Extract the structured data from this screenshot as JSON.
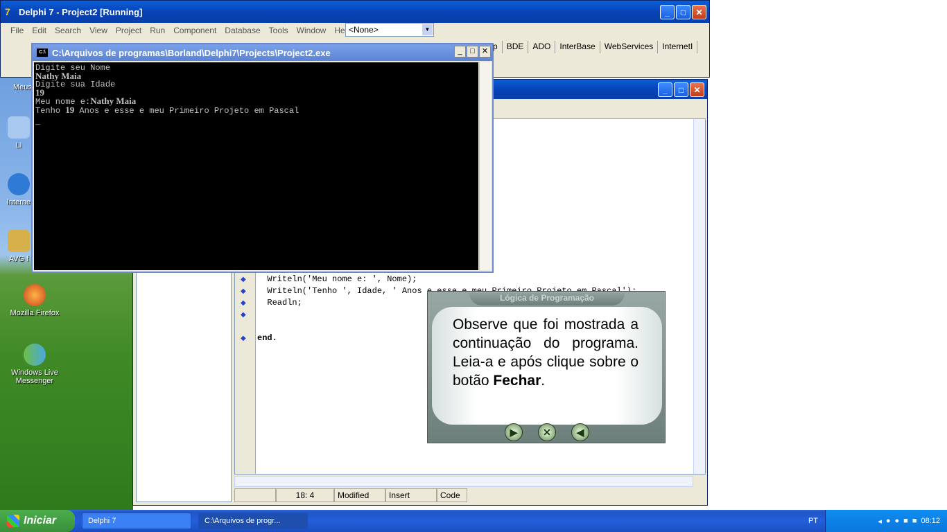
{
  "delphi": {
    "title": "Delphi 7 - Project2 [Running]",
    "menu": [
      "File",
      "Edit",
      "Search",
      "View",
      "Project",
      "Run",
      "Component",
      "Database",
      "Tools",
      "Window",
      "Help"
    ],
    "combo_value": "<None>",
    "palette_tabs": [
      "p",
      "BDE",
      "ADO",
      "InterBase",
      "WebServices",
      "InternetI"
    ]
  },
  "desktop": {
    "icons": [
      {
        "label": "Meus locais"
      },
      {
        "label": "Li"
      },
      {
        "label": "Interne"
      },
      {
        "label": "AVG f"
      },
      {
        "label": "Mozilla Firefox"
      },
      {
        "label": "Windows Live Messenger"
      }
    ]
  },
  "editor": {
    "lines": [
      "  Writeln('Meu nome e: ', Nome);",
      "  Writeln('Tenho ', Idade, ' Anos e esse e meu Primeiro Projeto em Pascal');",
      "  Readln;",
      "",
      "end."
    ],
    "status": {
      "position": "18:  4",
      "modified": "Modified",
      "mode": "Insert",
      "tab": "Code"
    }
  },
  "console": {
    "title": "C:\\Arquivos de programas\\Borland\\Delphi7\\Projects\\Project2.exe",
    "line1": "Digite seu Nome",
    "name": "Nathy Maia",
    "line3": "Digite sua Idade",
    "age": "19",
    "line5_prefix": "Meu nome e:",
    "line6_prefix": "Tenho",
    "line6_suffix": "  Anos e esse e meu Primeiro Projeto em Pascal",
    "cursor": "_"
  },
  "tutor": {
    "title": "Lógica de Programação",
    "text": "Observe que foi mostrada a continuação do programa. Leia-a e após clique sobre o botão ",
    "bold": "Fechar",
    "end": "."
  },
  "taskbar": {
    "start": "Iniciar",
    "tasks": [
      "Delphi 7",
      "C:\\Arquivos de progr..."
    ],
    "lang": "PT",
    "clock": "08:12"
  }
}
